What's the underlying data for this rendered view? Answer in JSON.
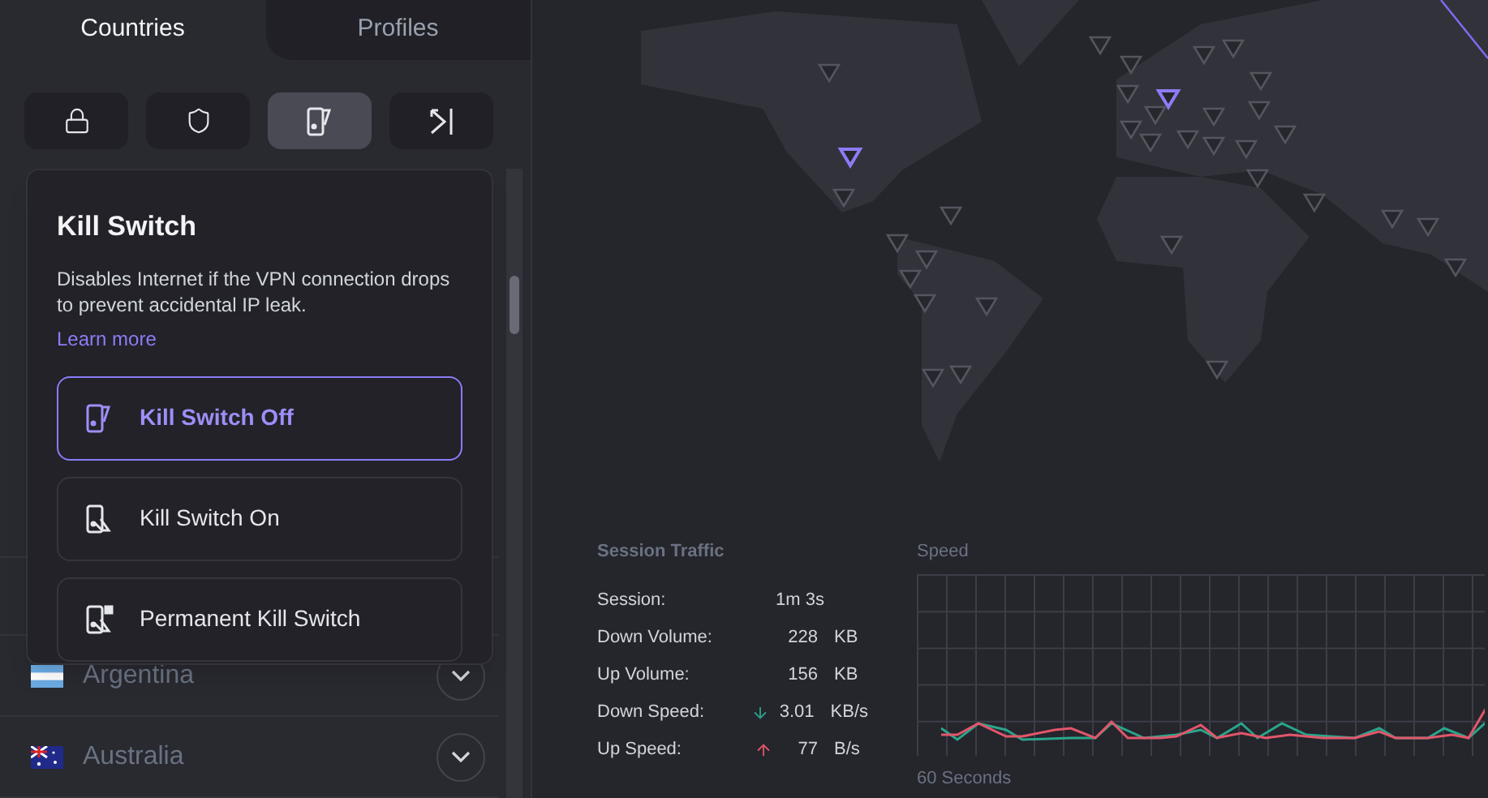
{
  "tabs": [
    {
      "label": "Countries",
      "selected": true
    },
    {
      "label": "Profiles",
      "selected": false
    }
  ],
  "feature_buttons": [
    {
      "kind": "lock",
      "selected": false
    },
    {
      "kind": "shield",
      "selected": false
    },
    {
      "kind": "killswitch",
      "selected": true
    },
    {
      "kind": "collapse",
      "selected": false
    }
  ],
  "popover": {
    "title": "Kill Switch",
    "description": "Disables Internet if the VPN connection drops to prevent accidental IP leak.",
    "link": "Learn more",
    "options": [
      {
        "kind": "off",
        "label": "Kill Switch Off",
        "selected": true
      },
      {
        "kind": "on",
        "label": "Kill Switch On",
        "selected": false
      },
      {
        "kind": "permanent",
        "label": "Permanent Kill Switch",
        "selected": false
      }
    ]
  },
  "countries": [
    {
      "name": "Argentina",
      "kind": "argentina"
    },
    {
      "name": "Australia",
      "kind": "australia"
    }
  ],
  "session_traffic": {
    "title": "Session Traffic",
    "rows": [
      {
        "label": "Session:",
        "value": "1m 3s"
      },
      {
        "label": "Down Volume:",
        "value": "228",
        "unit": "KB"
      },
      {
        "label": "Up Volume:",
        "value": "156",
        "unit": "KB"
      },
      {
        "label": "Down Speed:",
        "kind": "down",
        "value": "3.01",
        "unit": "KB/s"
      },
      {
        "label": "Up Speed:",
        "kind": "up",
        "value": "77",
        "unit": "B/s"
      }
    ]
  },
  "speed_chart": {
    "title": "Speed",
    "xlabel": "60 Seconds"
  }
}
